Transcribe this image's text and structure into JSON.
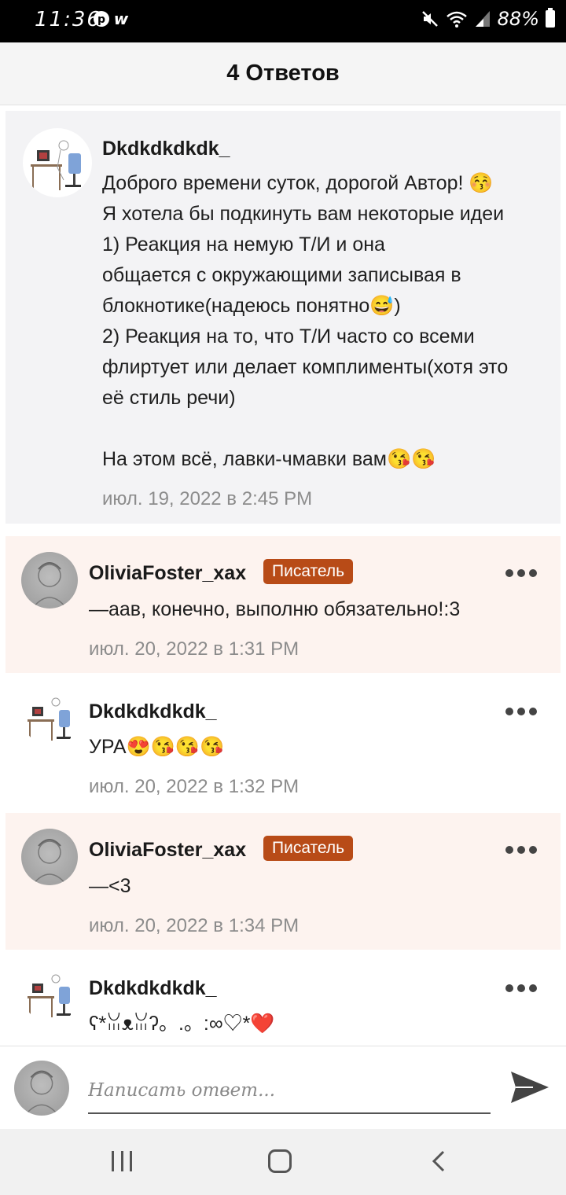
{
  "status_bar": {
    "time": "11:36",
    "battery": "88%"
  },
  "header": {
    "title": "4 Ответов"
  },
  "main_comment": {
    "username": "Dkdkdkdkdk_",
    "text": "Доброго времени суток, дорогой Автор! 😚\nЯ хотела бы подкинуть вам некоторые идеи\n1) Реакция на немую Т/И и она\nобщается с окружающими записывая в\nблокнотике(надеюсь понятно😅)\n2) Реакция на то, что Т/И часто со всеми\nфлиртует или делает комплименты(хотя это\neё стиль речи)\n\nНа этом всё, лавки-чмавки вам😘😘",
    "timestamp": "июл. 19, 2022 в 2:45 PM"
  },
  "replies": [
    {
      "username": "OliviaFoster_xax",
      "badge": "Писатель",
      "text": "—аав, конечно, выполню обязательно!:3",
      "timestamp": "июл. 20, 2022 в 1:31 PM"
    },
    {
      "username": "Dkdkdkdkdk_",
      "badge": "",
      "text": "УРА😍😘😘😘",
      "timestamp": "июл. 20, 2022 в 1:32 PM"
    },
    {
      "username": "OliviaFoster_xax",
      "badge": "Писатель",
      "text": "—<3",
      "timestamp": "июл. 20, 2022 в 1:34 PM"
    },
    {
      "username": "Dkdkdkdkdk_",
      "badge": "",
      "text": "ʕ*ꈍᴥꈍʔ。.。:∞♡*❤️",
      "timestamp": ""
    }
  ],
  "compose": {
    "placeholder": "Написать ответ..."
  },
  "colors": {
    "writer_badge": "#b84b17",
    "writer_row_bg": "#fdf3ef",
    "main_comment_bg": "#f3f3f5"
  }
}
